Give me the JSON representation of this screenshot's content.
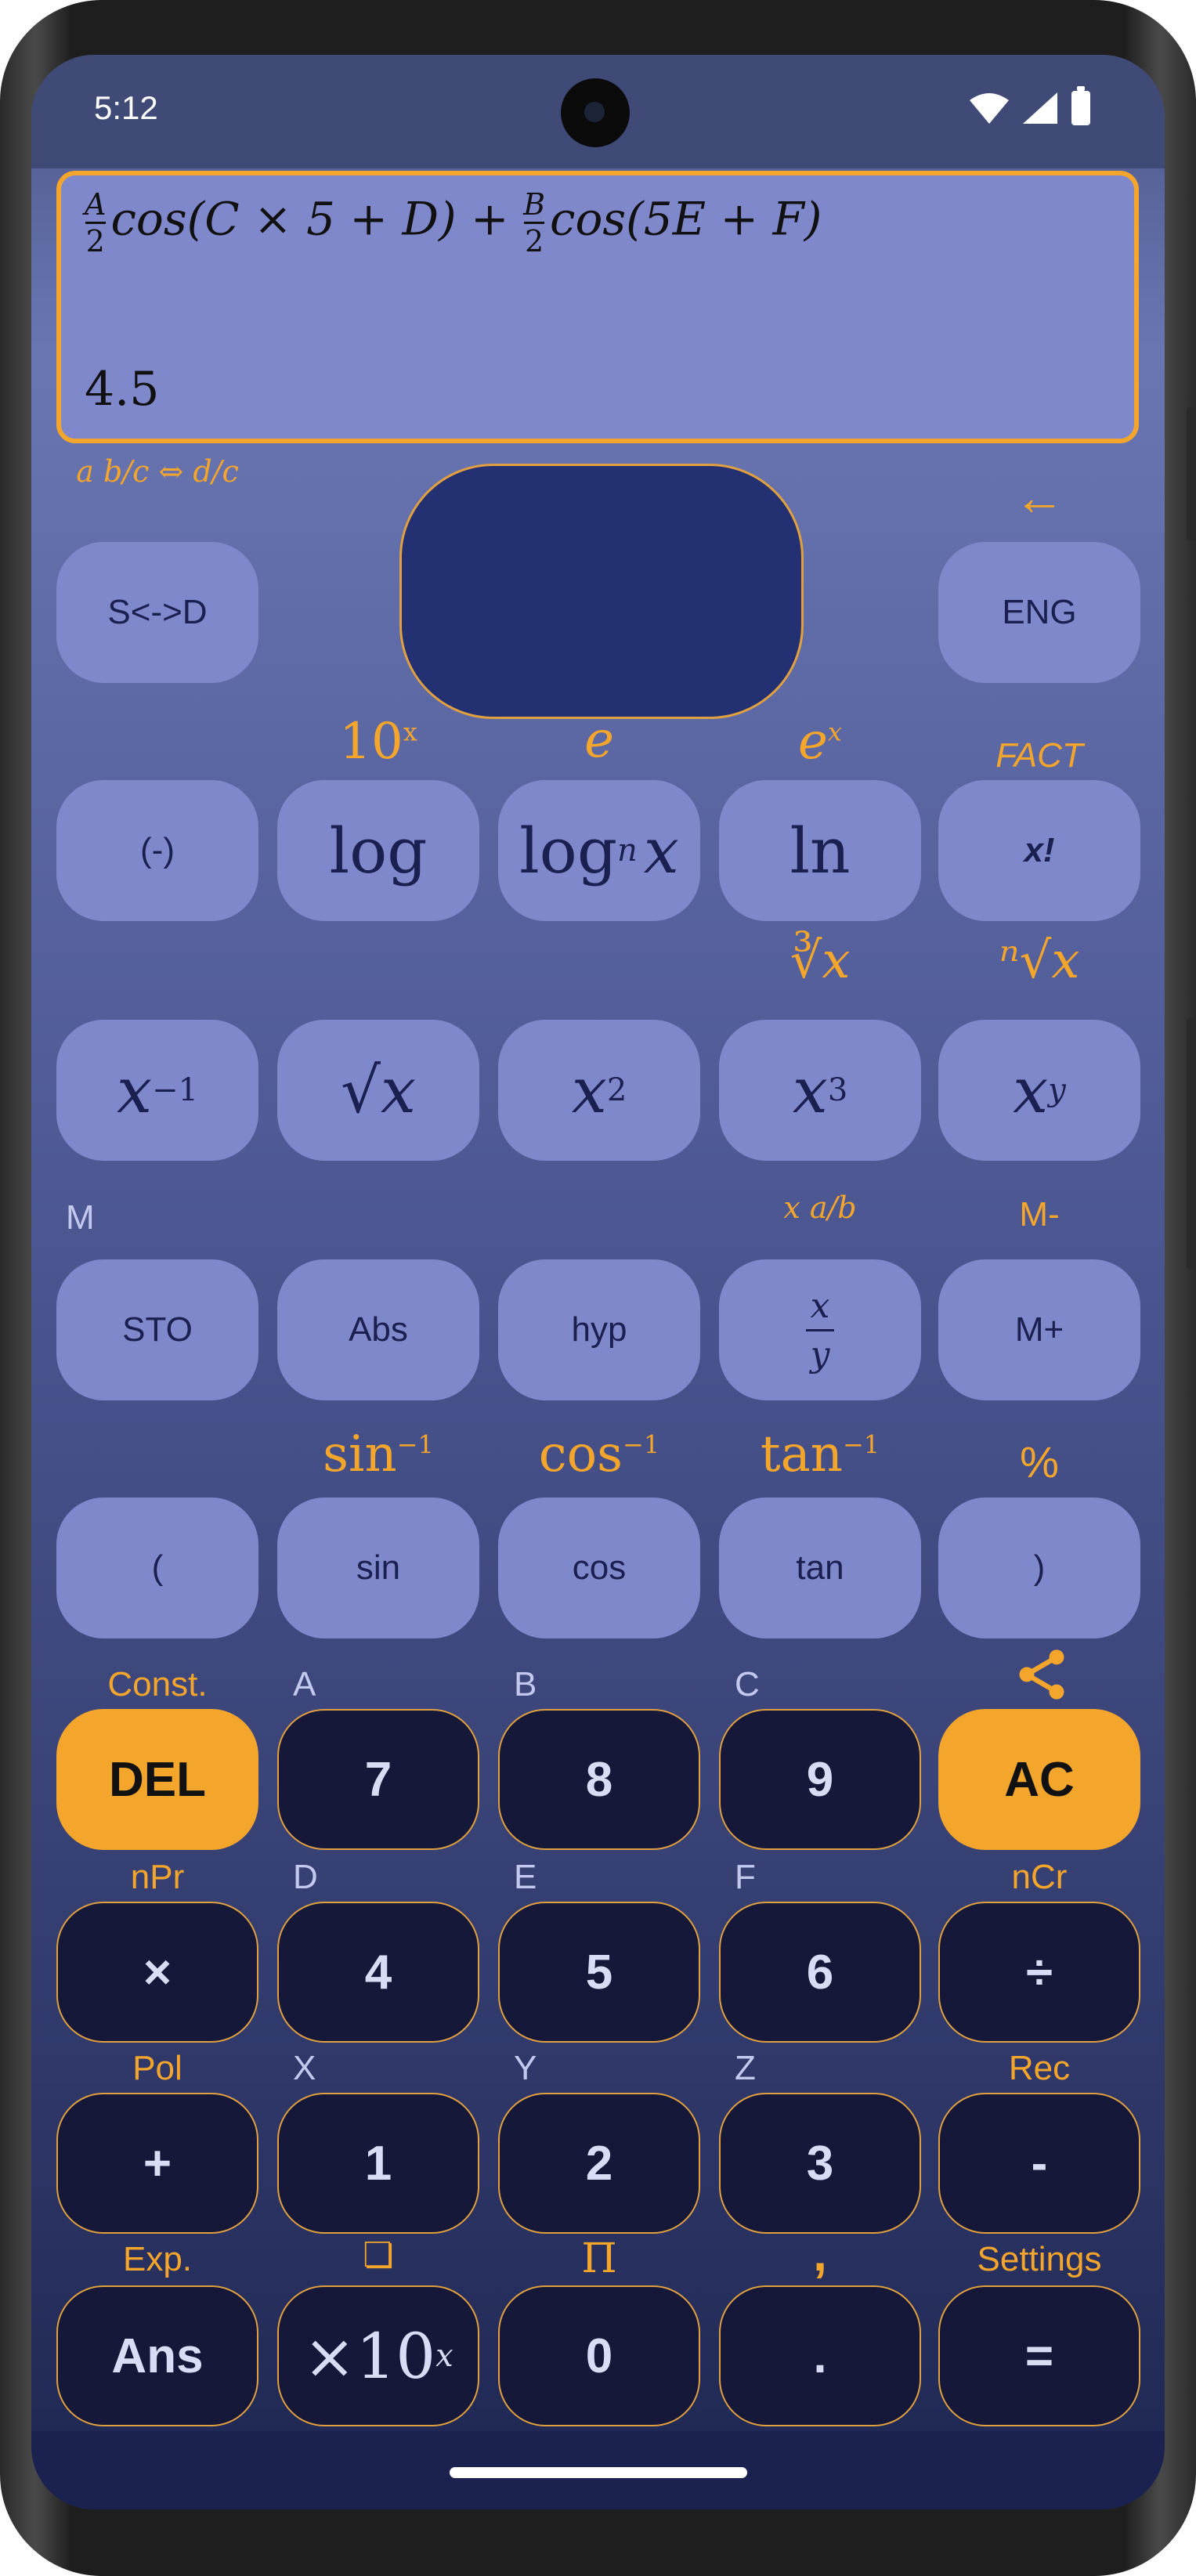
{
  "status": {
    "time": "5:12"
  },
  "display": {
    "expr_A": "A",
    "expr_two": "2",
    "expr_mid": "cos(C × 5 + D) + ",
    "expr_B": "B",
    "expr_end": "cos(5E + F)",
    "result": "4.5"
  },
  "labels": {
    "fraction_convert": "a b/c ⇔ d/c",
    "arrow_left": "←",
    "ten_pow_x": "10",
    "ten_pow_x_sup": "x",
    "e_const": "e",
    "e_pow_x": "e",
    "e_pow_x_sup": "x",
    "fact": "FACT",
    "cube_root": "∛x",
    "nth_root": "ⁿ√x",
    "memory": "M",
    "mixed_fraction": "x a/b",
    "m_minus": "M-",
    "asin": "sin",
    "acos": "cos",
    "atan": "tan",
    "inverse_sup": "−1",
    "percent": "%",
    "const": "Const.",
    "A": "A",
    "B": "B",
    "C": "C",
    "nPr": "nPr",
    "D": "D",
    "E": "E",
    "F": "F",
    "nCr": "nCr",
    "Pol": "Pol",
    "X": "X",
    "Y": "Y",
    "Z": "Z",
    "Rec": "Rec",
    "Exp": "Exp.",
    "copy": "❏",
    "pi": "Π",
    "comma": ",",
    "settings": "Settings"
  },
  "buttons": {
    "s_to_d": "S<->D",
    "eng": "ENG",
    "neg": "(-)",
    "log": "log",
    "logn": "log",
    "logn_sub": "n",
    "logn_x": "x",
    "ln": "ln",
    "fact": "x!",
    "inv": "x",
    "inv_sup": "−1",
    "sqrt": "√x",
    "sq": "x",
    "sq_sup": "2",
    "cube": "x",
    "cube_sup": "3",
    "pow": "x",
    "pow_sup": "y",
    "sto": "STO",
    "abs": "Abs",
    "hyp": "hyp",
    "frac_x": "x",
    "frac_y": "y",
    "m_plus": "M+",
    "lparen": "(",
    "sin": "sin",
    "cos": "cos",
    "tan": "tan",
    "rparen": ")",
    "del": "DEL",
    "seven": "7",
    "eight": "8",
    "nine": "9",
    "ac": "AC",
    "mul": "×",
    "four": "4",
    "five": "5",
    "six": "6",
    "div": "÷",
    "plus": "+",
    "one": "1",
    "two": "2",
    "three": "3",
    "minus": "-",
    "ans": "Ans",
    "times10": "×10",
    "times10_sup": "x",
    "zero": "0",
    "dot": ".",
    "equals": "="
  },
  "colors": {
    "accent": "#f4a52c",
    "key_light": "#8088cc",
    "key_dark": "#151838",
    "joystick": "#233071"
  }
}
